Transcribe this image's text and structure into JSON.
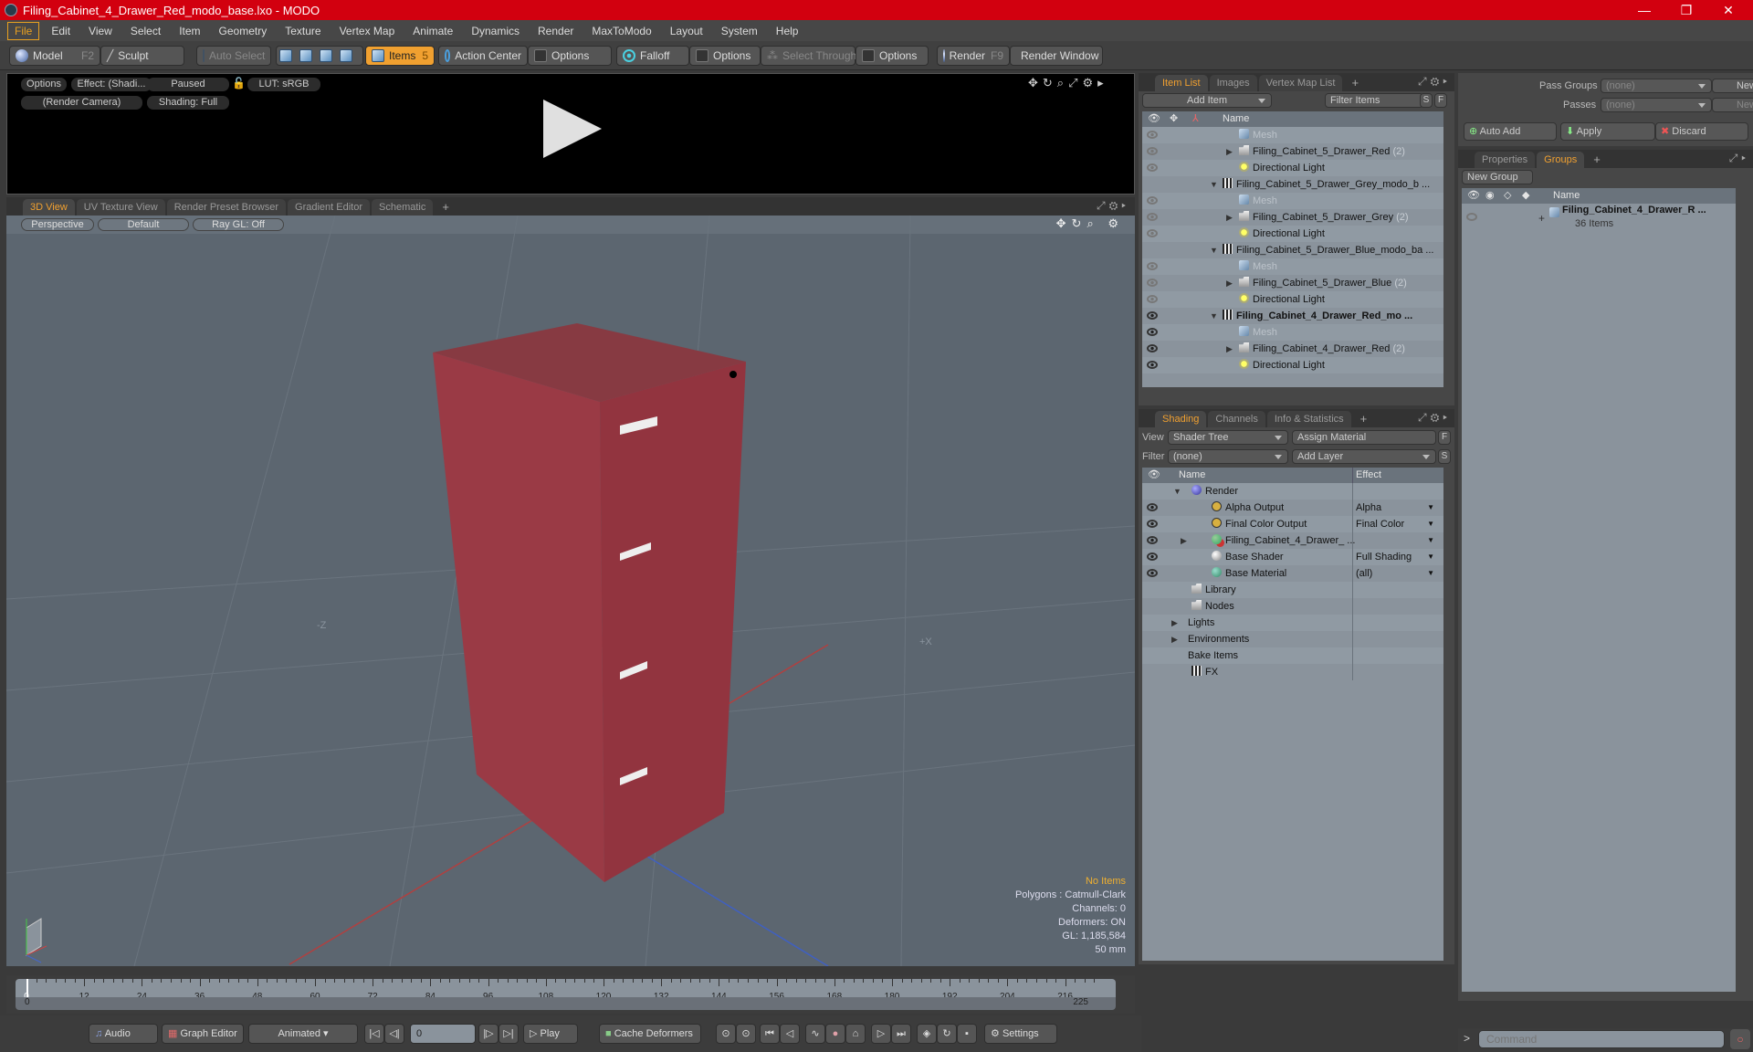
{
  "window": {
    "title": "Filing_Cabinet_4_Drawer_Red_modo_base.lxo - MODO",
    "controls": [
      "—",
      "❐",
      "✕"
    ]
  },
  "menu": [
    "File",
    "Edit",
    "View",
    "Select",
    "Item",
    "Geometry",
    "Texture",
    "Vertex Map",
    "Animate",
    "Dynamics",
    "Render",
    "MaxToModo",
    "Layout",
    "System",
    "Help"
  ],
  "toolbar": {
    "model": "Model",
    "model_key": "F2",
    "sculpt": "Sculpt",
    "auto_select": "Auto Select",
    "items": "Items",
    "items_key": "5",
    "action_center": "Action Center",
    "options1": "Options",
    "falloff": "Falloff",
    "options2": "Options",
    "select_through": "Select Through",
    "options3": "Options",
    "render": "Render",
    "render_key": "F9",
    "render_window": "Render Window"
  },
  "preview": {
    "options": "Options",
    "effect": "Effect: (Shadi...",
    "paused": "Paused",
    "lut": "LUT: sRGB",
    "camera": "(Render Camera)",
    "shading": "Shading: Full"
  },
  "view_tabs": [
    "3D View",
    "UV Texture View",
    "Render Preset Browser",
    "Gradient Editor",
    "Schematic",
    "+"
  ],
  "viewport": {
    "projection": "Perspective",
    "style": "Default",
    "raygl": "Ray GL: Off",
    "axis_labels": {
      "neg_z": "-Z",
      "pos_x": "+X"
    },
    "hud": {
      "selection": "No Items",
      "polygons": "Polygons : Catmull-Clark",
      "channels": "Channels: 0",
      "deformers": "Deformers: ON",
      "gl": "GL: 1,185,584",
      "scale": "50 mm"
    },
    "colors": {
      "background": "#5c6670",
      "object": "#93343f",
      "handle": "#eeeeee"
    }
  },
  "item_list": {
    "tabs": [
      "Item List",
      "Images",
      "Vertex Map List",
      "+"
    ],
    "add_item": "Add Item",
    "filter": "Filter Items",
    "s": "S",
    "f": "F",
    "col_name": "Name",
    "rows": [
      {
        "name": "Mesh",
        "type": "mesh",
        "depth": 2,
        "dim": true,
        "eye": "dim"
      },
      {
        "name": "Filing_Cabinet_5_Drawer_Red",
        "count": "(2)",
        "type": "folder",
        "depth": 2,
        "eye": "dim",
        "expand": "▶"
      },
      {
        "name": "Directional Light",
        "type": "light",
        "depth": 2,
        "eye": "dim"
      },
      {
        "name": "Filing_Cabinet_5_Drawer_Grey_modo_b ...",
        "type": "scene",
        "depth": 1,
        "expand": "▼"
      },
      {
        "name": "Mesh",
        "type": "mesh",
        "depth": 2,
        "dim": true,
        "eye": "dim"
      },
      {
        "name": "Filing_Cabinet_5_Drawer_Grey",
        "count": "(2)",
        "type": "folder",
        "depth": 2,
        "eye": "dim",
        "expand": "▶"
      },
      {
        "name": "Directional Light",
        "type": "light",
        "depth": 2,
        "eye": "dim"
      },
      {
        "name": "Filing_Cabinet_5_Drawer_Blue_modo_ba ...",
        "type": "scene",
        "depth": 1,
        "expand": "▼"
      },
      {
        "name": "Mesh",
        "type": "mesh",
        "depth": 2,
        "dim": true,
        "eye": "dim"
      },
      {
        "name": "Filing_Cabinet_5_Drawer_Blue",
        "count": "(2)",
        "type": "folder",
        "depth": 2,
        "eye": "dim",
        "expand": "▶"
      },
      {
        "name": "Directional Light",
        "type": "light",
        "depth": 2,
        "eye": "dim"
      },
      {
        "name": "Filing_Cabinet_4_Drawer_Red_mo ...",
        "type": "scene",
        "depth": 1,
        "bold": true,
        "eye": "on",
        "expand": "▼"
      },
      {
        "name": "Mesh",
        "type": "mesh",
        "depth": 2,
        "dim": true,
        "eye": "on"
      },
      {
        "name": "Filing_Cabinet_4_Drawer_Red",
        "count": "(2)",
        "type": "folder",
        "depth": 2,
        "eye": "on",
        "expand": "▶"
      },
      {
        "name": "Directional Light",
        "type": "light",
        "depth": 2,
        "eye": "on"
      }
    ]
  },
  "shading": {
    "tabs": [
      "Shading",
      "Channels",
      "Info & Statistics",
      "+"
    ],
    "view_label": "View",
    "view_value": "Shader Tree",
    "assign_material": "Assign Material",
    "f": "F",
    "filter_label": "Filter",
    "filter_value": "(none)",
    "add_layer": "Add Layer",
    "s": "S",
    "col_name": "Name",
    "col_effect": "Effect",
    "rows": [
      {
        "name": "Render",
        "icon": "render-sphere",
        "depth": 1,
        "expand": "▼"
      },
      {
        "name": "Alpha Output",
        "effect": "Alpha",
        "icon": "output",
        "depth": 2,
        "eye": true
      },
      {
        "name": "Final Color Output",
        "effect": "Final Color",
        "icon": "output",
        "depth": 2,
        "eye": true
      },
      {
        "name": "Filing_Cabinet_4_Drawer_ ...",
        "effect": "",
        "icon": "material-group",
        "depth": 2,
        "eye": true,
        "expand": "▶"
      },
      {
        "name": "Base Shader",
        "effect": "Full Shading",
        "icon": "shader",
        "depth": 2,
        "eye": true
      },
      {
        "name": "Base Material",
        "effect": "(all)",
        "icon": "material",
        "depth": 2,
        "eye": true
      },
      {
        "name": "Library",
        "icon": "folder",
        "depth": 1
      },
      {
        "name": "Nodes",
        "icon": "folder",
        "depth": 1
      },
      {
        "name": "Lights",
        "depth": 0,
        "expand": "▶"
      },
      {
        "name": "Environments",
        "depth": 0,
        "expand": "▶"
      },
      {
        "name": "Bake Items",
        "depth": 0
      },
      {
        "name": "FX",
        "icon": "scene",
        "depth": 1
      }
    ]
  },
  "passes": {
    "pass_groups_label": "Pass Groups",
    "pass_groups_value": "(none)",
    "passes_label": "Passes",
    "passes_value": "(none)",
    "new": "New",
    "auto_add": "Auto Add",
    "apply": "Apply",
    "discard": "Discard"
  },
  "groups": {
    "tabs": [
      "Properties",
      "Groups",
      "+"
    ],
    "new_group": "New Group",
    "col_name": "Name",
    "group_name": "Filing_Cabinet_4_Drawer_R ...",
    "group_count": "36 Items"
  },
  "timeline": {
    "ticks": [
      0,
      12,
      24,
      36,
      48,
      60,
      72,
      84,
      96,
      108,
      120,
      132,
      144,
      156,
      168,
      180,
      192,
      204,
      216
    ],
    "start": "0",
    "end": "225",
    "current_frame": "0"
  },
  "bottom": {
    "audio": "Audio",
    "graph_editor": "Graph Editor",
    "animated": "Animated",
    "play": "Play",
    "cache_deformers": "Cache Deformers",
    "settings": "Settings",
    "command_placeholder": "Command",
    "prompt": ">"
  }
}
